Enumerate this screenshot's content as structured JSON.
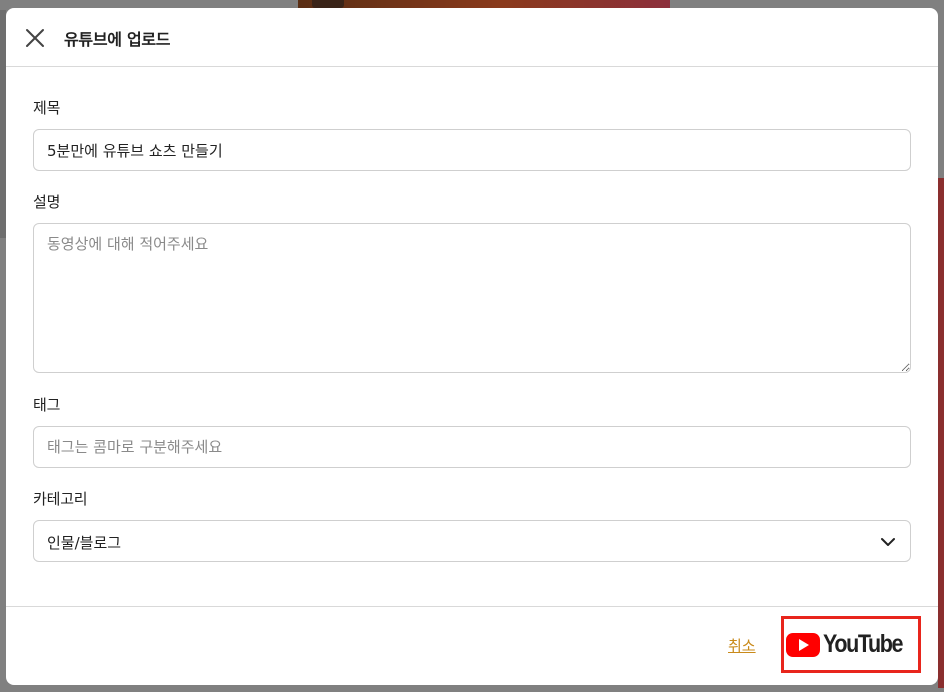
{
  "modal": {
    "title": "유튜브에 업로드",
    "close_icon": "close-icon"
  },
  "form": {
    "title_label": "제목",
    "title_value": "5분만에 유튜브 쇼츠 만들기",
    "description_label": "설명",
    "description_value": "",
    "description_placeholder": "동영상에 대해 적어주세요",
    "tags_label": "태그",
    "tags_value": "",
    "tags_placeholder": "태그는 콤마로 구분해주세요",
    "category_label": "카테고리",
    "category_selected": "인물/블로그",
    "category_icon": "chevron-down-icon"
  },
  "footer": {
    "cancel_label": "취소",
    "youtube_wordmark": "YouTube",
    "youtube_icon": "youtube-play-icon",
    "youtube_red": "#FF0000",
    "highlight_border": "#E8251C",
    "cancel_color": "#C98A1A"
  }
}
